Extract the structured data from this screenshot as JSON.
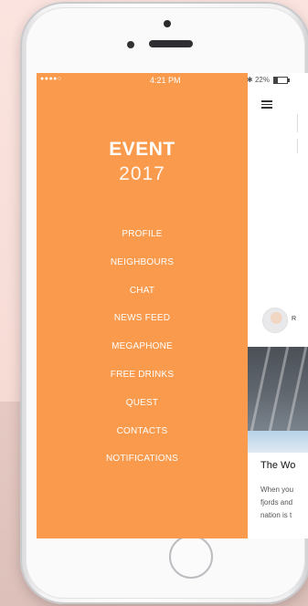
{
  "status": {
    "signal": "●●●●○ ",
    "time": "4:21 PM",
    "battery": "22%"
  },
  "brand": {
    "title": "EVENT",
    "year": "2017"
  },
  "menu": {
    "items": [
      "PROFILE",
      "NEIGHBOURS",
      "CHAT",
      "NEWS FEED",
      "MEGAPHONE",
      "FREE DRINKS",
      "QUEST",
      "CONTACTS",
      "NOTIFICATIONS"
    ]
  },
  "content": {
    "author_initial": "R",
    "article_title": "The Wo",
    "article_lines": [
      "When you",
      "fjords and",
      "nation is t"
    ]
  },
  "icons": {
    "menu": "hamburger-icon",
    "avatar": "avatar"
  },
  "colors": {
    "menu_bg": "#f99a4c",
    "menu_text": "#ffffff"
  }
}
